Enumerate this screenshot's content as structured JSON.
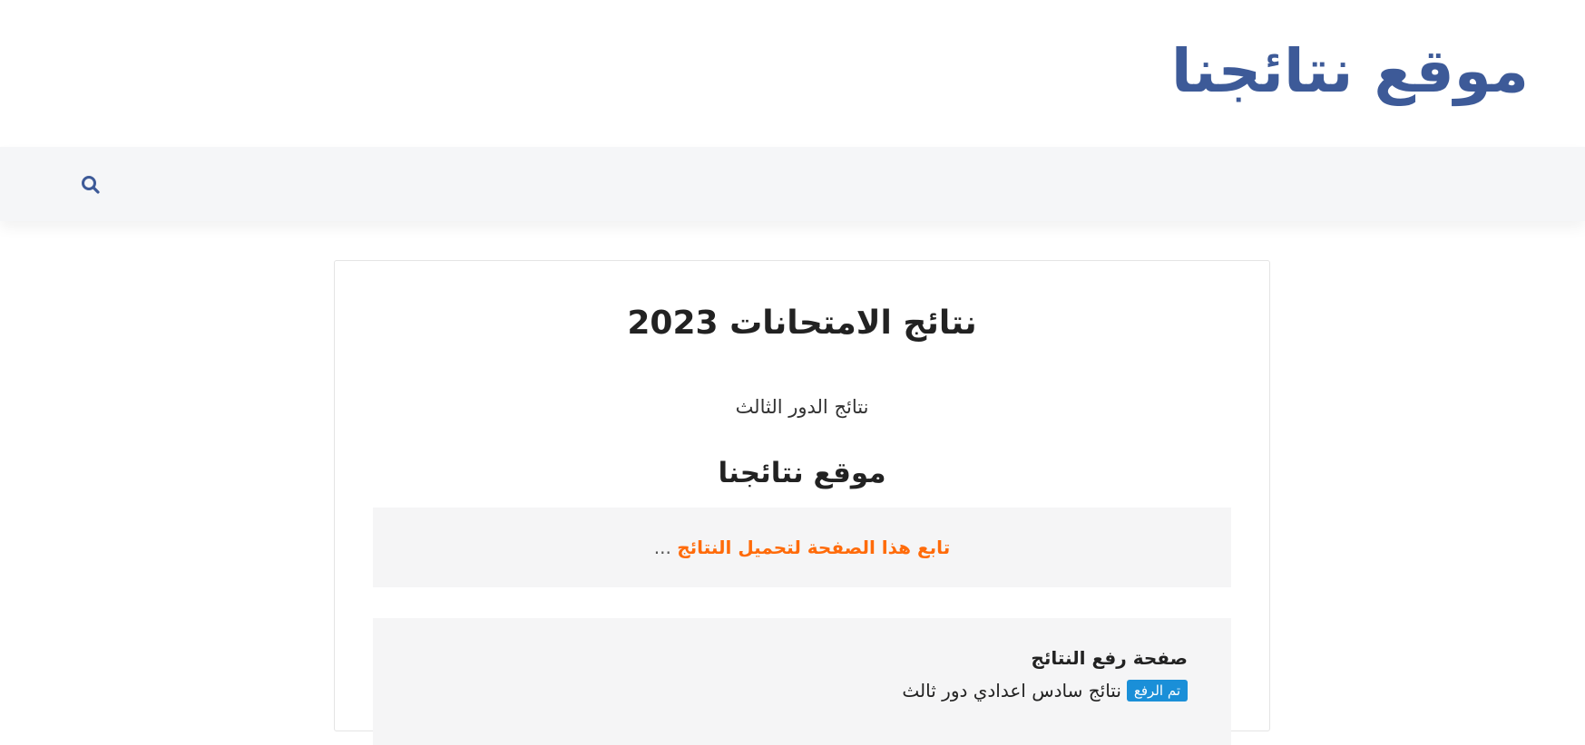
{
  "header": {
    "site_title": "موقع نتائجنا"
  },
  "navbar": {
    "search_icon": "search-icon"
  },
  "article": {
    "title": "نتائج الامتحانات 2023",
    "subtitle": "نتائج الدور الثالث",
    "heading": "موقع نتائجنا",
    "notice": {
      "link_text": "تابع هذا الصفحة لتحميل النتائج",
      "ellipsis": "..."
    },
    "results": {
      "heading": "صفحة رفع النتائج",
      "items": [
        {
          "badge": "تم الرفع",
          "text": "نتائج سادس اعدادي دور ثالث"
        }
      ]
    }
  },
  "colors": {
    "brand": "#3d5a98",
    "notice_link": "#ff6b0a",
    "badge": "#1a8fd8",
    "navbar_bg": "#f5f6f8"
  }
}
